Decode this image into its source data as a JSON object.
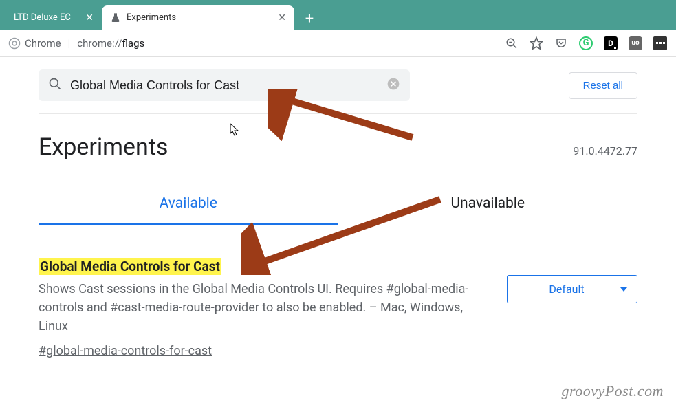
{
  "tabs": [
    {
      "title": "LTD Deluxe EC",
      "active": false
    },
    {
      "title": "Experiments",
      "active": true
    }
  ],
  "addressBar": {
    "appLabel": "Chrome",
    "urlPrefix": "chrome://",
    "urlPath": "flags"
  },
  "search": {
    "value": "Global Media Controls for Cast"
  },
  "resetLabel": "Reset all",
  "pageTitle": "Experiments",
  "version": "91.0.4472.77",
  "flagTabs": {
    "available": "Available",
    "unavailable": "Unavailable"
  },
  "flag": {
    "title": "Global Media Controls for Cast",
    "description": "Shows Cast sessions in the Global Media Controls UI. Requires #global-media-controls and #cast-media-route-provider to also be enabled. – Mac, Windows, Linux",
    "id": "#global-media-controls-for-cast",
    "selectValue": "Default"
  },
  "watermark": "groovyPost.com"
}
